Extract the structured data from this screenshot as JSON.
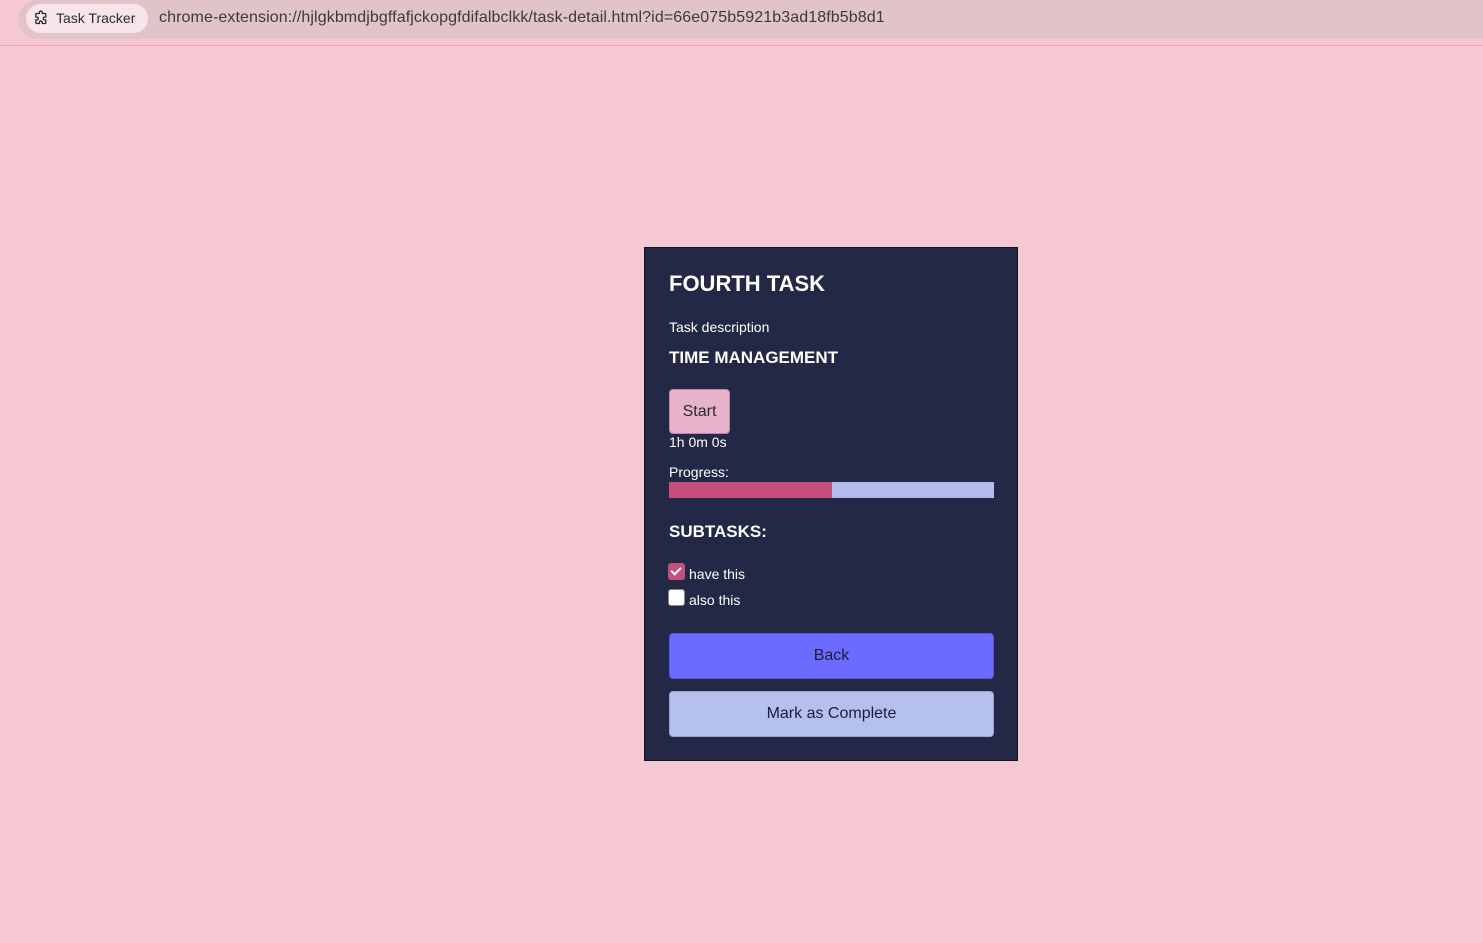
{
  "browser": {
    "tab_title": "Task Tracker",
    "tab_icon": "puzzle-icon",
    "url": "chrome-extension://hjlgkbmdjbgffafjckopgfdifalbclkk/task-detail.html?id=66e075b5921b3ad18fb5b8d1"
  },
  "task": {
    "title": "FOURTH TASK",
    "description": "Task description",
    "category": "TIME MANAGEMENT",
    "start_label": "Start",
    "timer": "1h 0m 0s",
    "progress_label": "Progress:",
    "progress_fraction": 0.5
  },
  "subtasks": {
    "heading": "SUBTASKS:",
    "items": [
      {
        "label": "have this",
        "checked": true
      },
      {
        "label": "also this",
        "checked": false
      }
    ]
  },
  "actions": {
    "back_label": "Back",
    "complete_label": "Mark as Complete"
  },
  "colors": {
    "page_background": "#f6c8d2",
    "card_background": "#222845",
    "progress_fill": "#c44f7b",
    "progress_track": "#b3bcea",
    "back_button": "#6b6bff",
    "complete_button": "#b6c0ee",
    "start_button": "#e7b3c9"
  }
}
